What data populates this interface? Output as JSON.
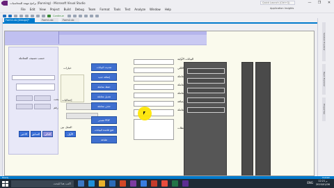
{
  "window": {
    "title": "برامج مهمة للمحاسبات (Running) - Microsoft Visual Studio",
    "quick_launch_placeholder": "Quick Launch (Ctrl+Q)",
    "controls": [
      "—",
      "❐",
      "✕"
    ]
  },
  "menu": {
    "items": [
      "File",
      "Edit",
      "View",
      "Project",
      "Build",
      "Debug",
      "Team",
      "Format",
      "Tools",
      "Test",
      "Analyze",
      "Window",
      "Help"
    ],
    "account": "Application Insights"
  },
  "toolbar": {
    "start_label": "Continue"
  },
  "tabs": {
    "active": "Form1.vb [Design]*",
    "second": "Form1.vb",
    "third": "Form2.vb"
  },
  "form": {
    "left_panel": {
      "heading": "حسب تصنيف المعاملة",
      "label_a": "بحث",
      "label_b": "رقم",
      "nav_buttons": [
        "الاخير",
        "السابق",
        "التالي",
        "الأول"
      ]
    },
    "middle": {
      "heading": "خيارات",
      "label_total": "إجماليات",
      "label_move": "التنقل بين"
    },
    "action_buttons": [
      "تحديث البيانات",
      "إضافة جديد",
      "حفظ معاملة",
      "تعديل معاملة",
      "حذف معاملة",
      "تصدير PDF",
      "فتح قاعدة البيانات",
      "طباعة"
    ],
    "right_labels": [
      "البيانات الأولية",
      "السجل الكلي",
      "صاحب المعاملة",
      "موضوع المعاملة",
      "رقم المعاملة",
      "تاريخ الإضافة",
      "تصنيف المعاملة",
      "ملاحظات"
    ]
  },
  "right_tool_tabs": [
    "Solution Explorer",
    "Team Explorer",
    "Properties"
  ],
  "status": {
    "left": "Ready",
    "right": "Publish"
  },
  "taskbar": {
    "search_placeholder": "اكتب هنا للبحث",
    "time": "12:21 م",
    "date": "2019/01/06",
    "lang": "ENG"
  },
  "colors": {
    "accent": "#007acc",
    "form_band": "#c9c9f2",
    "action_button": "#3f6fcf",
    "dark_group": "#565656",
    "cursor_highlight": "#ffe600"
  }
}
